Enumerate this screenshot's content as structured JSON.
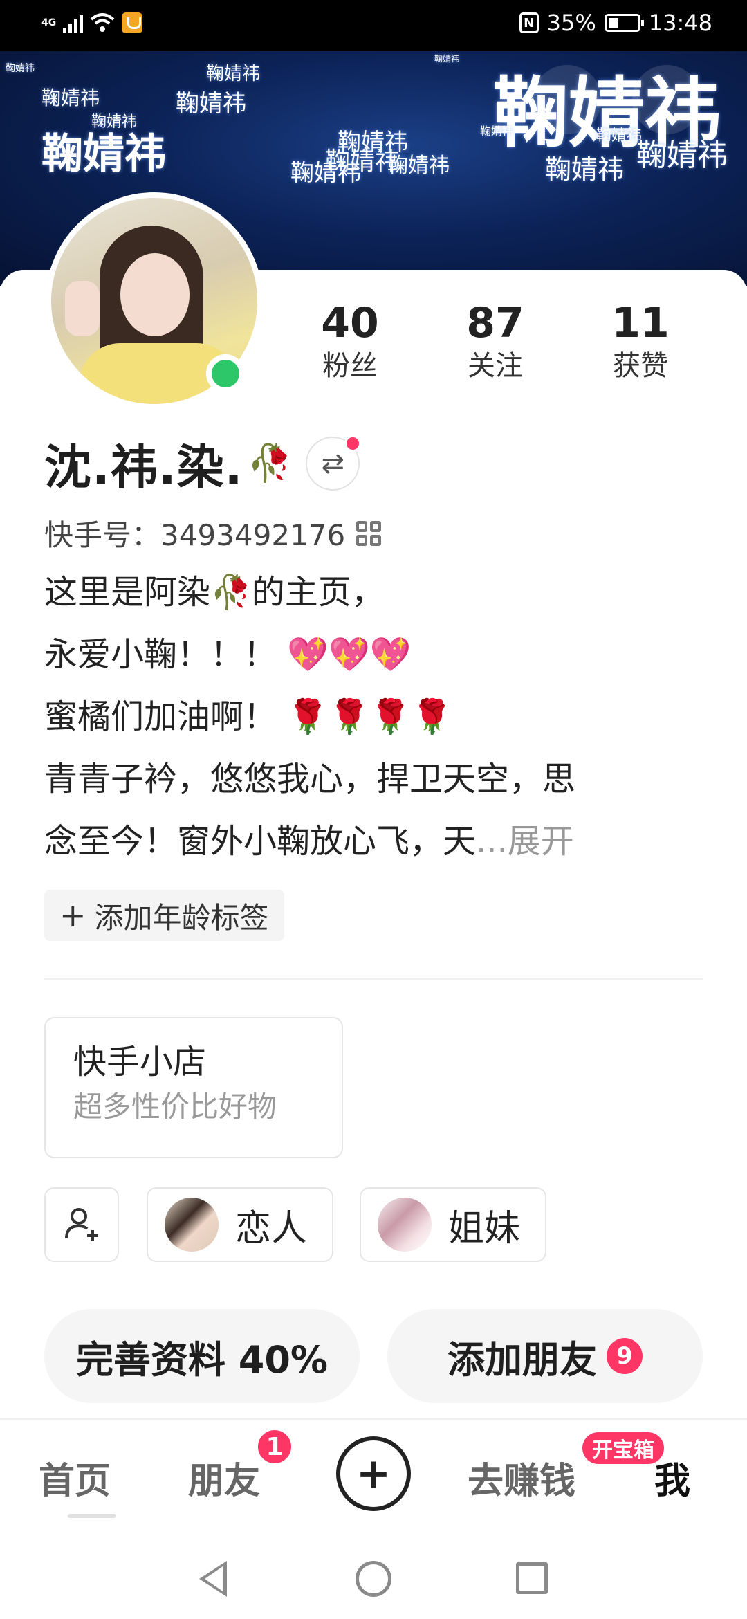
{
  "status_bar": {
    "network": "4G",
    "battery_percent": "35%",
    "time": "13:48",
    "nfc_label": "N"
  },
  "banner": {
    "words": [
      "鞠婧祎",
      "鞠婧祎",
      "鞠婧祎",
      "鞠婧祎",
      "鞠婧祎",
      "鞠婧祎",
      "鞠婧祎",
      "鞠婧祎",
      "鞠婧祎",
      "鞠婧祎",
      "鞠婧祎",
      "鞠婧祎",
      "鞠婧祎",
      "鞠婧祎",
      "鞠婧祎",
      "鞠婧祎"
    ]
  },
  "profile": {
    "name": "沈.祎.染.",
    "name_emoji": "🥀",
    "switch_icon": "⇄",
    "kuaishou_id_label": "快手号：",
    "kuaishou_id": "3493492176",
    "stats": [
      {
        "value": "40",
        "label": "粉丝"
      },
      {
        "value": "87",
        "label": "关注"
      },
      {
        "value": "11",
        "label": "获赞"
      }
    ],
    "bio": {
      "line1_a": "这里是阿染",
      "line1_emoji": "🥀",
      "line1_b": "的主页，",
      "line2_a": "永爱小鞠！！！",
      "line2_emoji": "💖💖💖",
      "line3_a": "蜜橘们加油啊！",
      "line3_emoji": "🌹🌹🌹🌹",
      "line4": "青青子衿，悠悠我心，捍卫天空，思",
      "line5": "念至今！窗外小鞠放心飞，天",
      "ellipsis": "...",
      "expand": "展开"
    },
    "age_tag": {
      "icon": "+",
      "label": "添加年龄标签"
    }
  },
  "shop": {
    "title": "快手小店",
    "subtitle": "超多性价比好物"
  },
  "relations": [
    {
      "label": "恋人"
    },
    {
      "label": "姐妹"
    }
  ],
  "actions": {
    "complete_profile": "完善资料 40%",
    "add_friends": "添加朋友",
    "add_friends_badge": "9"
  },
  "bottom_nav": {
    "home": "首页",
    "friends": "朋友",
    "friends_badge": "1",
    "plus": "+",
    "earn": "去赚钱",
    "treasure": "开宝箱",
    "me": "我"
  },
  "colors": {
    "accent": "#fe3666",
    "online": "#2dc76a",
    "banner_dark": "#061233"
  }
}
